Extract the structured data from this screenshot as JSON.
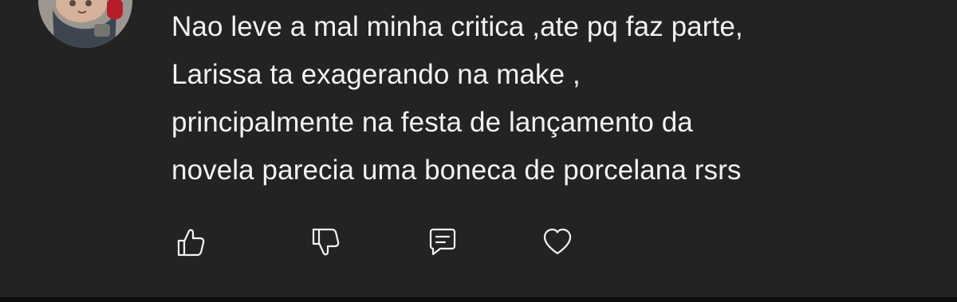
{
  "comment": {
    "avatar_icon": "user-avatar",
    "text_lines": [
      "Nao leve a mal minha critica ,ate pq faz parte,",
      "Larissa ta exagerando na make ,",
      "principalmente na festa de lançamento da",
      "novela parecia uma boneca de porcelana rsrs"
    ],
    "actions": {
      "like_icon": "thumbs-up-icon",
      "dislike_icon": "thumbs-down-icon",
      "reply_icon": "message-square-icon",
      "heart_icon": "heart-icon"
    }
  },
  "colors": {
    "background": "#232323",
    "text": "#f2f2f2",
    "icon": "#f4f4f4",
    "bottom_bar": "#0d0d0d"
  }
}
